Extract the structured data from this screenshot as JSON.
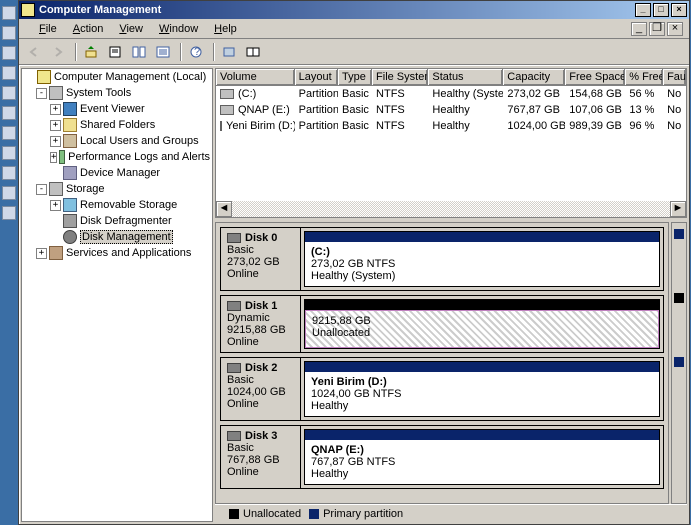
{
  "title": "Computer Management",
  "menu": {
    "file": "File",
    "action": "Action",
    "view": "View",
    "window": "Window",
    "help": "Help"
  },
  "tree": {
    "root": "Computer Management (Local)",
    "systools": "System Tools",
    "event": "Event Viewer",
    "shared": "Shared Folders",
    "users": "Local Users and Groups",
    "perf": "Performance Logs and Alerts",
    "device": "Device Manager",
    "storage": "Storage",
    "remov": "Removable Storage",
    "defrag": "Disk Defragmenter",
    "diskmgmt": "Disk Management",
    "services": "Services and Applications"
  },
  "cols": {
    "volume": "Volume",
    "layout": "Layout",
    "type": "Type",
    "fs": "File System",
    "status": "Status",
    "capacity": "Capacity",
    "free": "Free Space",
    "pfree": "% Free",
    "fault": "Faul"
  },
  "vols": [
    {
      "name": "(C:)",
      "layout": "Partition",
      "type": "Basic",
      "fs": "NTFS",
      "status": "Healthy (System)",
      "cap": "273,02 GB",
      "free": "154,68 GB",
      "pfree": "56 %",
      "fault": "No"
    },
    {
      "name": "QNAP (E:)",
      "layout": "Partition",
      "type": "Basic",
      "fs": "NTFS",
      "status": "Healthy",
      "cap": "767,87 GB",
      "free": "107,06 GB",
      "pfree": "13 %",
      "fault": "No"
    },
    {
      "name": "Yeni Birim (D:)",
      "layout": "Partition",
      "type": "Basic",
      "fs": "NTFS",
      "status": "Healthy",
      "cap": "1024,00 GB",
      "free": "989,39 GB",
      "pfree": "96 %",
      "fault": "No"
    }
  ],
  "disks": [
    {
      "name": "Disk 0",
      "type": "Basic",
      "size": "273,02 GB",
      "state": "Online",
      "part": {
        "label": "(C:)",
        "line2": "273,02 GB NTFS",
        "line3": "Healthy (System)",
        "bar": "primary"
      }
    },
    {
      "name": "Disk 1",
      "type": "Dynamic",
      "size": "9215,88 GB",
      "state": "Online",
      "part": {
        "label": "",
        "line2": "9215,88 GB",
        "line3": "Unallocated",
        "bar": "black",
        "hatch": true
      }
    },
    {
      "name": "Disk 2",
      "type": "Basic",
      "size": "1024,00 GB",
      "state": "Online",
      "part": {
        "label": "Yeni Birim  (D:)",
        "line2": "1024,00 GB NTFS",
        "line3": "Healthy",
        "bar": "primary"
      }
    },
    {
      "name": "Disk 3",
      "type": "Basic",
      "size": "767,88 GB",
      "state": "Online",
      "part": {
        "label": "QNAP  (E:)",
        "line2": "767,87 GB NTFS",
        "line3": "Healthy",
        "bar": "primary"
      }
    }
  ],
  "legend": {
    "unalloc": "Unallocated",
    "primary": "Primary partition"
  }
}
